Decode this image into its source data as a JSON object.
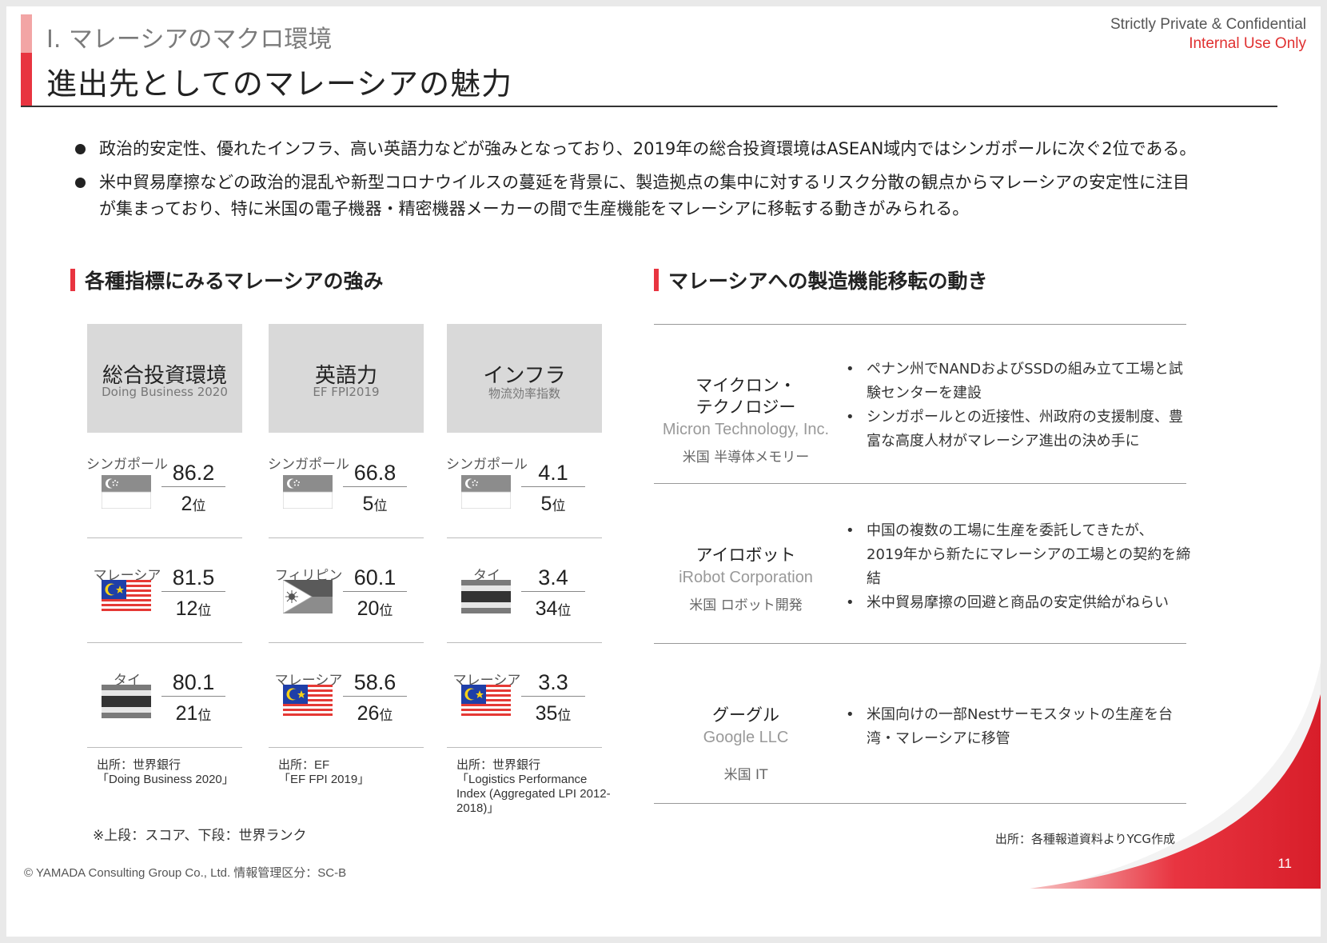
{
  "header": {
    "section": "I. マレーシアのマクロ環境",
    "title": "進出先としてのマレーシアの魅力",
    "confidential": "Strictly Private & Confidential",
    "internal": "Internal Use Only"
  },
  "bullets": [
    "政治的安定性、優れたインフラ、高い英語力などが強みとなっており、2019年の総合投資環境はASEAN域内ではシンガポールに次ぐ2位である。",
    "米中貿易摩擦などの政治的混乱や新型コロナウイルスの蔓延を背景に、製造拠点の集中に対するリスク分散の観点からマレーシアの安定性に注目",
    "が集まっており、特に米国の電子機器・精密機器メーカーの間で生産機能をマレーシアに移転する動きがみられる。"
  ],
  "left_heading": "各種指標にみるマレーシアの強み",
  "right_heading": "マレーシアへの製造機能移転の動き",
  "indicators": [
    {
      "title": "総合投資環境",
      "subtitle": "Doing Business 2020",
      "rows": [
        {
          "country": "シンガポール",
          "flag": "singapore-flag",
          "score": "86.2",
          "rank": "2",
          "unit": "位"
        },
        {
          "country": "マレーシア",
          "flag": "malaysia-flag",
          "score": "81.5",
          "rank": "12",
          "unit": "位"
        },
        {
          "country": "タイ",
          "flag": "thailand-flag",
          "score": "80.1",
          "rank": "21",
          "unit": "位"
        }
      ],
      "source": [
        "出所：世界銀行",
        "「Doing Business 2020」"
      ]
    },
    {
      "title": "英語力",
      "subtitle": "EF FPI2019",
      "rows": [
        {
          "country": "シンガポール",
          "flag": "singapore-flag",
          "score": "66.8",
          "rank": "5",
          "unit": "位"
        },
        {
          "country": "フィリピン",
          "flag": "philippines-flag",
          "score": "60.1",
          "rank": "20",
          "unit": "位"
        },
        {
          "country": "マレーシア",
          "flag": "malaysia-flag",
          "score": "58.6",
          "rank": "26",
          "unit": "位"
        }
      ],
      "source": [
        "出所：EF",
        "「EF FPI 2019」"
      ]
    },
    {
      "title": "インフラ",
      "subtitle": "物流効率指数",
      "rows": [
        {
          "country": "シンガポール",
          "flag": "singapore-flag",
          "score": "4.1",
          "rank": "5",
          "unit": "位"
        },
        {
          "country": "タイ",
          "flag": "thailand-flag",
          "score": "3.4",
          "rank": "34",
          "unit": "位"
        },
        {
          "country": "マレーシア",
          "flag": "malaysia-flag",
          "score": "3.3",
          "rank": "35",
          "unit": "位"
        }
      ],
      "source": [
        "出所：世界銀行",
        "「Logistics Performance",
        "Index (Aggregated LPI 2012-",
        "2018)」"
      ]
    }
  ],
  "note": "※上段：スコア、下段：世界ランク",
  "companies": [
    {
      "name_ja": [
        "マイクロン・",
        "テクノロジー"
      ],
      "name_en": "Micron Technology, Inc.",
      "sector": "米国 半導体メモリー",
      "points": [
        [
          "ペナン州でNANDおよびSSDの組み立て工場と試",
          "験センターを建設"
        ],
        [
          "シンガポールとの近接性、州政府の支援制度、豊",
          "富な高度人材がマレーシア進出の決め手に"
        ]
      ]
    },
    {
      "name_ja": [
        "アイロボット"
      ],
      "name_en": "iRobot Corporation",
      "sector": "米国 ロボット開発",
      "points": [
        [
          "中国の複数の工場に生産を委託してきたが、",
          "2019年から新たにマレーシアの工場との契約を締",
          "結"
        ],
        [
          "米中貿易摩擦の回避と商品の安定供給がねらい"
        ]
      ]
    },
    {
      "name_ja": [
        "グーグル"
      ],
      "name_en": "Google LLC",
      "sector": "米国 IT",
      "points": [
        [
          "米国向けの一部Nestサーモスタットの生産を台",
          "湾・マレーシアに移管"
        ]
      ]
    }
  ],
  "right_source": "出所：各種報道資料よりYCG作成",
  "footer": "© YAMADA Consulting Group Co., Ltd. 情報管理区分：SC-B",
  "page_number": "11",
  "colors": {
    "accent": "#e83440",
    "header_gray": "#d9d9d9"
  }
}
